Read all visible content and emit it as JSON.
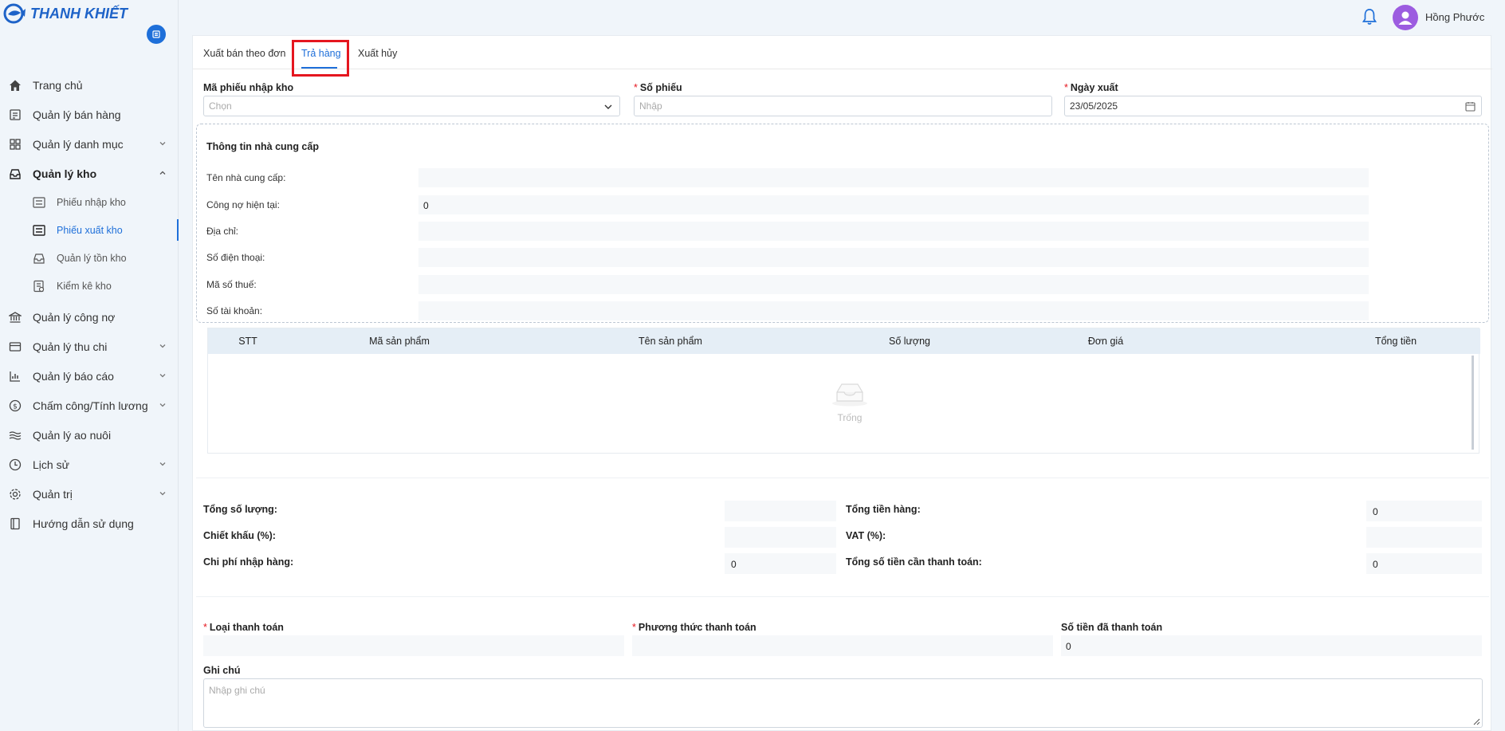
{
  "app": {
    "brand": "THANH KHIẾT"
  },
  "sidebar": {
    "items": [
      {
        "label": "Trang chủ",
        "icon": "home-icon"
      },
      {
        "label": "Quản lý bán hàng",
        "icon": "receipt-icon"
      },
      {
        "label": "Quản lý danh mục",
        "icon": "grid-icon"
      },
      {
        "label": "Quản lý kho",
        "icon": "inbox-icon"
      },
      {
        "label": "Quản lý công nợ",
        "icon": "bank-icon"
      },
      {
        "label": "Quản lý thu chi",
        "icon": "wallet-icon"
      },
      {
        "label": "Quản lý báo cáo",
        "icon": "bar-chart-icon"
      },
      {
        "label": "Chấm công/Tính lương",
        "icon": "dollar-icon"
      },
      {
        "label": "Quản lý ao nuôi",
        "icon": "waves-icon"
      },
      {
        "label": "Lịch sử",
        "icon": "history-icon"
      },
      {
        "label": "Quản trị",
        "icon": "gear-icon"
      },
      {
        "label": "Hướng dẫn sử dụng",
        "icon": "book-icon"
      }
    ],
    "warehouse_sub": [
      {
        "label": "Phiếu nhập kho",
        "icon": "import-icon"
      },
      {
        "label": "Phiếu xuất kho",
        "icon": "export-icon"
      },
      {
        "label": "Quản lý tồn kho",
        "icon": "inbox-icon"
      },
      {
        "label": "Kiểm kê kho",
        "icon": "checklist-icon"
      }
    ]
  },
  "header": {
    "username": "Hồng Phước"
  },
  "tabs": [
    {
      "label": "Xuất bán theo đơn"
    },
    {
      "label": "Trả hàng"
    },
    {
      "label": "Xuất hủy"
    }
  ],
  "form": {
    "receipt_label": "Mã phiếu nhập kho",
    "receipt_placeholder": "Chọn",
    "number_label": "Số phiếu",
    "number_placeholder": "Nhập",
    "date_label": "Ngày xuất",
    "date_value": "23/05/2025"
  },
  "supplier": {
    "title": "Thông tin nhà cung cấp",
    "rows": [
      {
        "label": "Tên nhà cung cấp:",
        "value": ""
      },
      {
        "label": "Công nợ hiện tại:",
        "value": "0"
      },
      {
        "label": "Địa chỉ:",
        "value": ""
      },
      {
        "label": "Số điện thoại:",
        "value": ""
      },
      {
        "label": "Mã số thuế:",
        "value": ""
      },
      {
        "label": "Số tài khoản:",
        "value": ""
      }
    ]
  },
  "table": {
    "columns": [
      "STT",
      "Mã sản phẩm",
      "Tên sản phẩm",
      "Số lượng",
      "Đơn giá",
      "Tổng tiền"
    ],
    "empty_text": "Trống"
  },
  "summary": {
    "total_qty_label": "Tổng số lượng:",
    "total_qty_value": "",
    "discount_label": "Chiết khấu (%):",
    "discount_value": "",
    "import_cost_label": "Chi phí nhập hàng:",
    "import_cost_value": "0",
    "total_goods_label": "Tổng tiền hàng:",
    "total_goods_value": "0",
    "vat_label": "VAT (%):",
    "vat_value": "",
    "total_payable_label": "Tổng số tiền cần thanh toán:",
    "total_payable_value": "0"
  },
  "payment": {
    "type_label": "Loại thanh toán",
    "type_value": "",
    "method_label": "Phương thức thanh toán",
    "method_value": "",
    "paid_label": "Số tiền đã thanh toán",
    "paid_value": "0",
    "note_label": "Ghi chú",
    "note_placeholder": "Nhập ghi chú"
  },
  "colors": {
    "primary": "#1e6fd9",
    "highlight": "#e5161f",
    "avatar": "#9c5ce0"
  }
}
